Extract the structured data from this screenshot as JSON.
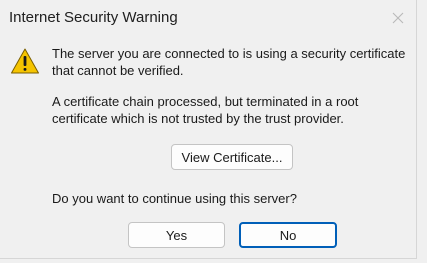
{
  "window": {
    "title": "Internet Security Warning",
    "close_icon": "close-icon"
  },
  "message": {
    "icon": "warning-icon",
    "line1": "The server you are connected to is using a security certificate that cannot be verified.",
    "line2": "A certificate chain processed, but terminated in a root certificate which is not trusted by the trust provider."
  },
  "buttons": {
    "view_certificate": "View Certificate...",
    "yes": "Yes",
    "no": "No"
  },
  "question": "Do you want to continue using this server?",
  "colors": {
    "warning_fill": "#f5c400",
    "focus_border": "#005fb8",
    "background": "#f0f0f0"
  }
}
